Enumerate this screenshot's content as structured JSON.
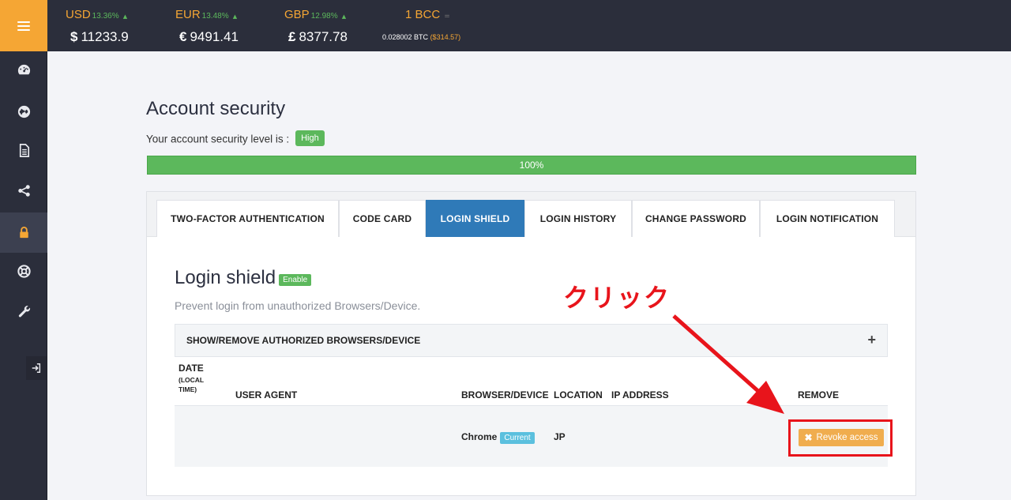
{
  "ticker": [
    {
      "currency": "USD",
      "change": "13.36%",
      "symbol": "$",
      "value": "11233.9"
    },
    {
      "currency": "EUR",
      "change": "13.48%",
      "symbol": "€",
      "value": "9491.41"
    },
    {
      "currency": "GBP",
      "change": "12.98%",
      "symbol": "£",
      "value": "8377.78"
    }
  ],
  "bcc": {
    "label": "1 BCC",
    "indicator": "=",
    "btc_value": "0.028002 BTC",
    "usd_value": "($314.57)"
  },
  "sidebar": {
    "icons": [
      "dashboard-icon",
      "globe-icon",
      "document-icon",
      "share-icon",
      "lock-icon",
      "lifebuoy-icon",
      "wrench-icon"
    ],
    "active_index": 4
  },
  "page": {
    "title": "Account security",
    "level_text": "Your account security level is :",
    "level_badge": "High",
    "progress_label": "100%",
    "progress_value": 100
  },
  "tabs": [
    "TWO-FACTOR AUTHENTICATION",
    "CODE CARD",
    "LOGIN SHIELD",
    "LOGIN HISTORY",
    "CHANGE PASSWORD",
    "LOGIN NOTIFICATION"
  ],
  "active_tab": "LOGIN SHIELD",
  "login_shield": {
    "title": "Login shield",
    "status_badge": "Enable",
    "description": "Prevent login from unauthorized Browsers/Device.",
    "collapse_label": "SHOW/REMOVE AUTHORIZED BROWSERS/DEVICE",
    "collapse_icon": "+",
    "headers": {
      "date": "DATE",
      "date_sub": "(LOCAL",
      "date_sub2": "TIME)",
      "user_agent": "USER AGENT",
      "browser": "BROWSER/DEVICE",
      "location": "LOCATION",
      "ip": "IP ADDRESS",
      "remove": "REMOVE"
    },
    "rows": [
      {
        "date": "",
        "user_agent": "",
        "browser": "Chrome",
        "browser_badge": "Current",
        "location": "JP",
        "ip": "",
        "action": "Revoke access"
      }
    ]
  },
  "annotation": {
    "text": "クリック",
    "color": "#e8141b"
  },
  "colors": {
    "accent": "#f5a634",
    "sidebar": "#2b2e3b",
    "success": "#5cb85c",
    "primary": "#2f7ab8",
    "info": "#5bc0de",
    "warning": "#f0ad4e"
  }
}
